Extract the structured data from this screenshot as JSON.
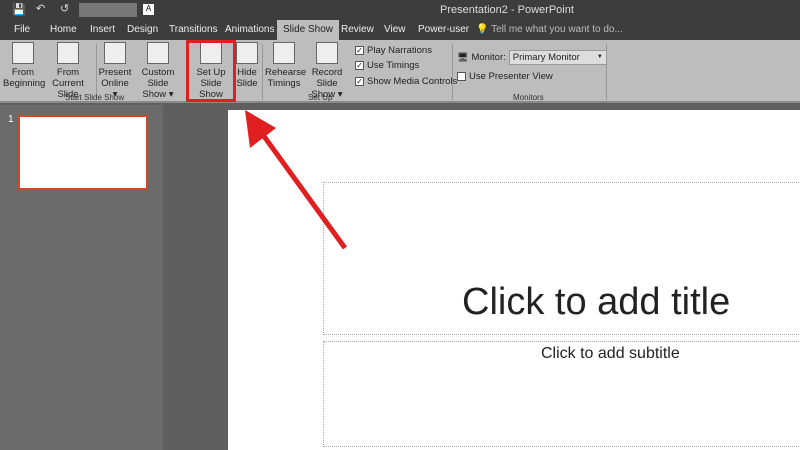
{
  "window": {
    "title": "Presentation2 - PowerPoint"
  },
  "tabs": [
    "File",
    "Home",
    "Insert",
    "Design",
    "Transitions",
    "Animations",
    "Slide Show",
    "Review",
    "View",
    "Power-user"
  ],
  "tell_me": "Tell me what you want to do...",
  "ribbon": {
    "from_beginning": [
      "From",
      "Beginning"
    ],
    "from_current": [
      "From",
      "Current Slide"
    ],
    "present_online": [
      "Present",
      "Online ▾"
    ],
    "custom_show": [
      "Custom Slide",
      "Show ▾"
    ],
    "setup_show": [
      "Set Up",
      "Slide Show"
    ],
    "hide_slide": [
      "Hide",
      "Slide"
    ],
    "rehearse": [
      "Rehearse",
      "Timings"
    ],
    "record": [
      "Record Slide",
      "Show ▾"
    ],
    "play_narrations": "Play Narrations",
    "use_timings": "Use Timings",
    "show_media": "Show Media Controls",
    "monitor_label": "Monitor:",
    "monitor_value": "Primary Monitor",
    "presenter_view": "Use Presenter View",
    "groups": {
      "start": "Start Slide Show",
      "setup": "Set Up",
      "monitors": "Monitors"
    }
  },
  "slide_number": "1",
  "slide": {
    "title": "Click to add title",
    "subtitle": "Click to add subtitle"
  },
  "colors": {
    "highlight": "#e02020",
    "accent": "#d24726"
  }
}
